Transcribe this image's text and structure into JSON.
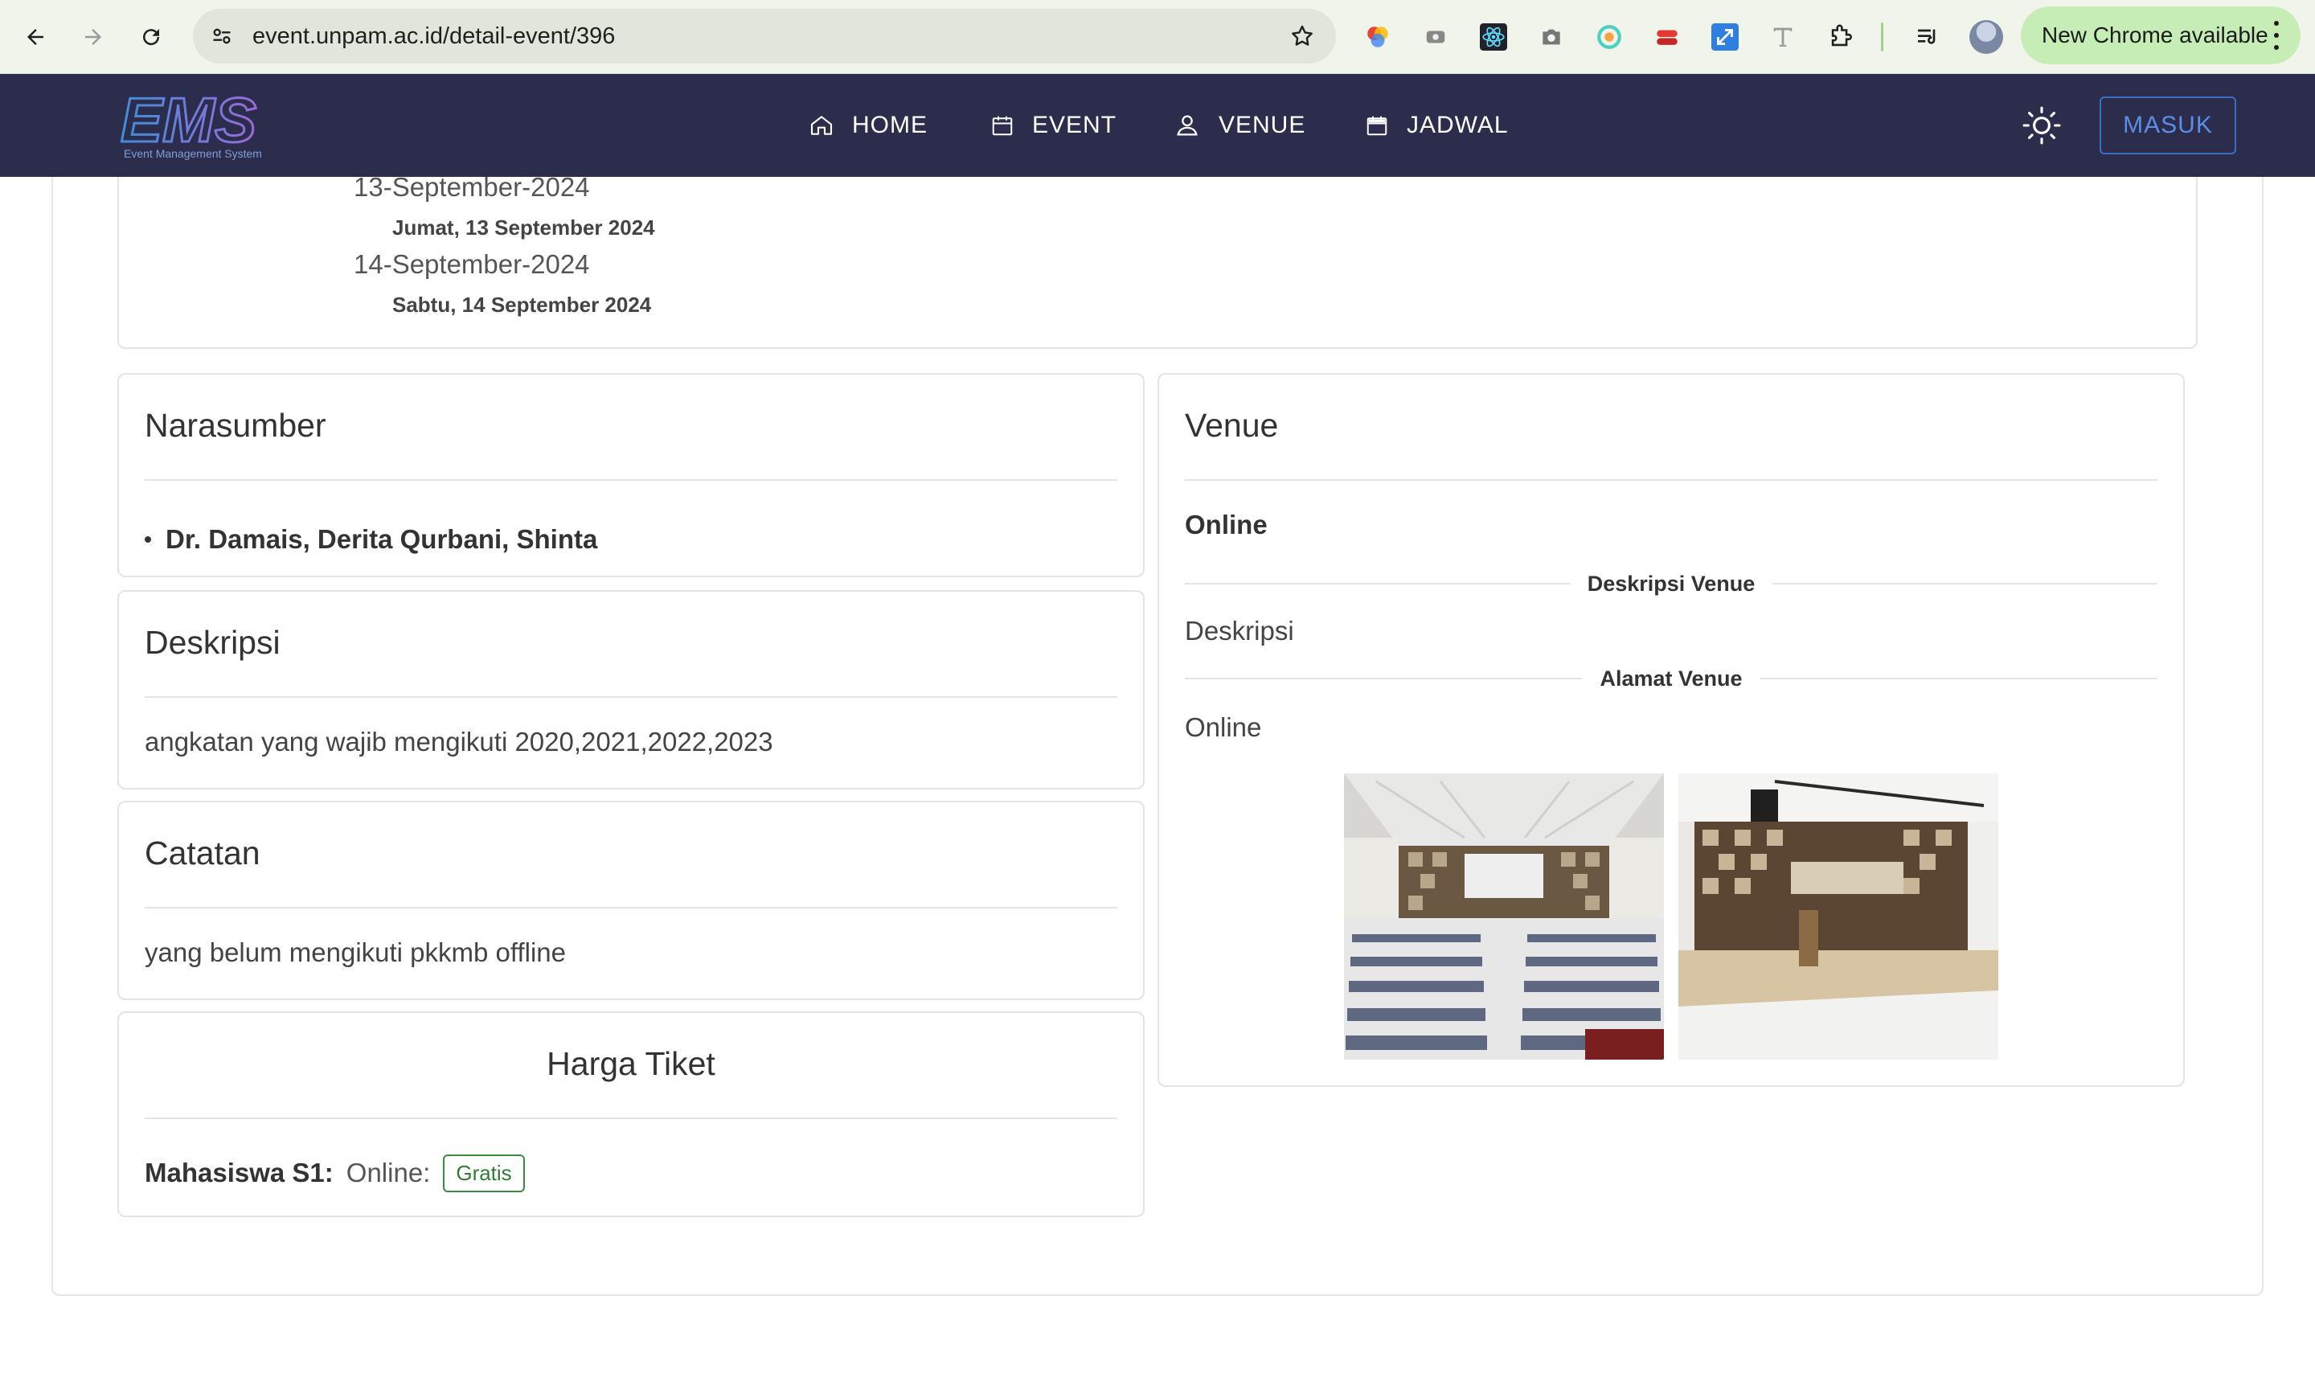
{
  "browser": {
    "url": "event.unpam.ac.id/detail-event/396",
    "update_label": "New Chrome available"
  },
  "navbar": {
    "logo_text": "EMS",
    "logo_tagline": "Event Management System",
    "items": [
      {
        "label": "HOME",
        "icon": "home-icon"
      },
      {
        "label": "EVENT",
        "icon": "calendar-icon"
      },
      {
        "label": "VENUE",
        "icon": "person-pin-icon"
      },
      {
        "label": "JADWAL",
        "icon": "calendar-icon"
      }
    ],
    "login_label": "MASUK"
  },
  "schedule": [
    {
      "date": "13-September-2024",
      "day": "Jumat, 13 September 2024"
    },
    {
      "date": "14-September-2024",
      "day": "Sabtu, 14 September 2024"
    }
  ],
  "narasumber": {
    "title": "Narasumber",
    "speakers": [
      "Dr. Damais, Derita Qurbani, Shinta"
    ]
  },
  "deskripsi": {
    "title": "Deskripsi",
    "text": "angkatan yang wajib mengikuti 2020,2021,2022,2023"
  },
  "catatan": {
    "title": "Catatan",
    "text": "yang belum mengikuti pkkmb offline"
  },
  "harga_tiket": {
    "title": "Harga Tiket",
    "category": "Mahasiswa S1:",
    "mode": "Online:",
    "price_badge": "Gratis"
  },
  "venue": {
    "title": "Venue",
    "name": "Online",
    "desc_label": "Deskripsi Venue",
    "desc": "Deskripsi",
    "address_label": "Alamat Venue",
    "address": "Online"
  },
  "colors": {
    "navbar_bg": "#2c2c4c",
    "accent": "#3b6fc4",
    "badge_green": "#2e7d32"
  }
}
